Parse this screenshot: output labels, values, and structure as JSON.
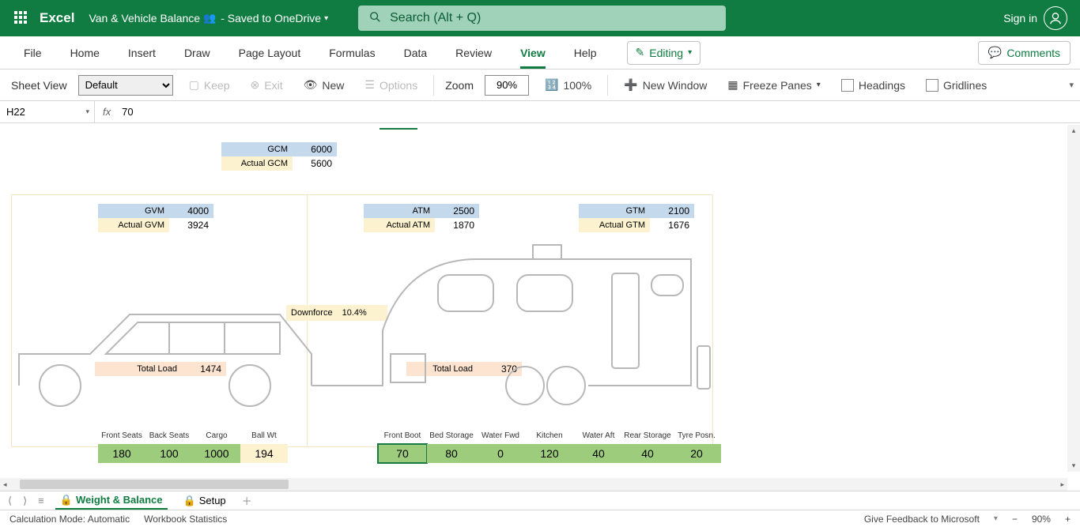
{
  "title": {
    "app": "Excel",
    "doc": "Van & Vehicle Balance",
    "saved": "- Saved to OneDrive"
  },
  "search": {
    "placeholder": "Search (Alt + Q)"
  },
  "signin": "Sign in",
  "tabs": {
    "file": "File",
    "home": "Home",
    "insert": "Insert",
    "draw": "Draw",
    "layout": "Page Layout",
    "formulas": "Formulas",
    "data": "Data",
    "review": "Review",
    "view": "View",
    "help": "Help",
    "editing": "Editing",
    "comments": "Comments"
  },
  "ribbon": {
    "sheetview": "Sheet View",
    "default": "Default",
    "keep": "Keep",
    "exit": "Exit",
    "new": "New",
    "options": "Options",
    "zoom": "Zoom",
    "zoomval": "90%",
    "hundred": "100%",
    "newwin": "New Window",
    "freeze": "Freeze Panes",
    "headings": "Headings",
    "gridlines": "Gridlines"
  },
  "fbar": {
    "name": "H22",
    "fx": "fx",
    "formula": "70"
  },
  "data": {
    "gcm": {
      "lab": "GCM",
      "val": "6000"
    },
    "agcm": {
      "lab": "Actual GCM",
      "val": "5600"
    },
    "gvm": {
      "lab": "GVM",
      "val": "4000"
    },
    "agvm": {
      "lab": "Actual GVM",
      "val": "3924"
    },
    "atm": {
      "lab": "ATM",
      "val": "2500"
    },
    "aatm": {
      "lab": "Actual ATM",
      "val": "1870"
    },
    "gtm": {
      "lab": "GTM",
      "val": "2100"
    },
    "agtm": {
      "lab": "Actual GTM",
      "val": "1676"
    },
    "downforce": {
      "lab": "Downforce",
      "val": "10.4%"
    },
    "tl1": {
      "lab": "Total Load",
      "val": "1474"
    },
    "tl2": {
      "lab": "Total Load",
      "val": "370"
    }
  },
  "row": {
    "car": [
      {
        "lab": "Front Seats",
        "val": "180"
      },
      {
        "lab": "Back Seats",
        "val": "100"
      },
      {
        "lab": "Cargo",
        "val": "1000"
      },
      {
        "lab": "Ball Wt",
        "val": "194"
      }
    ],
    "van": [
      {
        "lab": "Front Boot",
        "val": "70"
      },
      {
        "lab": "Bed Storage",
        "val": "80"
      },
      {
        "lab": "Water Fwd",
        "val": "0"
      },
      {
        "lab": "Kitchen",
        "val": "120"
      },
      {
        "lab": "Water Aft",
        "val": "40"
      },
      {
        "lab": "Rear Storage",
        "val": "40"
      },
      {
        "lab": "Tyre Posn.",
        "val": "20"
      }
    ]
  },
  "sheettabs": {
    "t1": "Weight & Balance",
    "t2": "Setup"
  },
  "status": {
    "calc": "Calculation Mode: Automatic",
    "stats": "Workbook Statistics",
    "feedback": "Give Feedback to Microsoft",
    "zoom": "90%"
  }
}
